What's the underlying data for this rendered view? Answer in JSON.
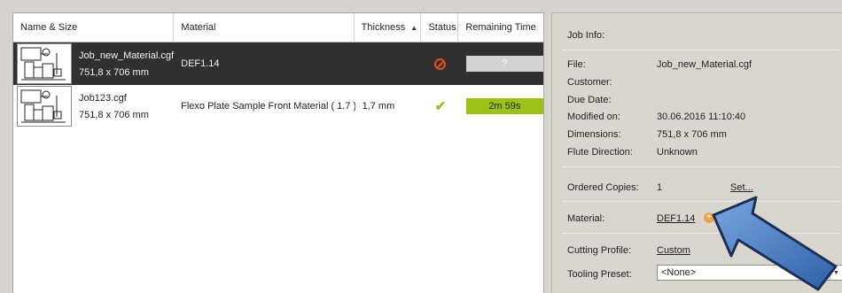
{
  "job_list": {
    "columns": {
      "name": "Name & Size",
      "material": "Material",
      "thickness": "Thickness",
      "status": "Status",
      "remaining": "Remaining Time"
    },
    "rows": [
      {
        "name": "Job_new_Material.cgf",
        "size": "751,8 x 706 mm",
        "material": "DEF1.14",
        "thickness": "",
        "status": "cancel-icon",
        "remaining": "?",
        "selected": true
      },
      {
        "name": "Job123.cgf",
        "size": "751,8 x 706 mm",
        "material": "Flexo Plate Sample Front Material ( 1.7 )",
        "thickness": "1,7 mm",
        "status": "check-icon",
        "remaining": "2m 59s",
        "selected": false
      }
    ]
  },
  "job_info": {
    "title": "Job Info:",
    "file_label": "File:",
    "file_value": "Job_new_Material.cgf",
    "customer_label": "Customer:",
    "due_date_label": "Due Date:",
    "modified_label": "Modified on:",
    "modified_value": "30.06.2016 11:10:40",
    "dimensions_label": "Dimensions:",
    "dimensions_value": "751,8 x 706 mm",
    "flute_label": "Flute Direction:",
    "flute_value": "Unknown",
    "copies_label": "Ordered Copies:",
    "copies_value": "1",
    "copies_link": "Set...",
    "material_label": "Material:",
    "material_value": "DEF1.14",
    "cutting_label": "Cutting Profile:",
    "cutting_value": "Custom",
    "tooling_label": "Tooling Preset:",
    "tooling_value": "<None>"
  },
  "colors": {
    "selected_row": "#303030",
    "progress_green": "#9cc21a",
    "callout_blue": "#4a7fc3",
    "status_error": "#e04e1c",
    "status_ok": "#95c11f"
  }
}
